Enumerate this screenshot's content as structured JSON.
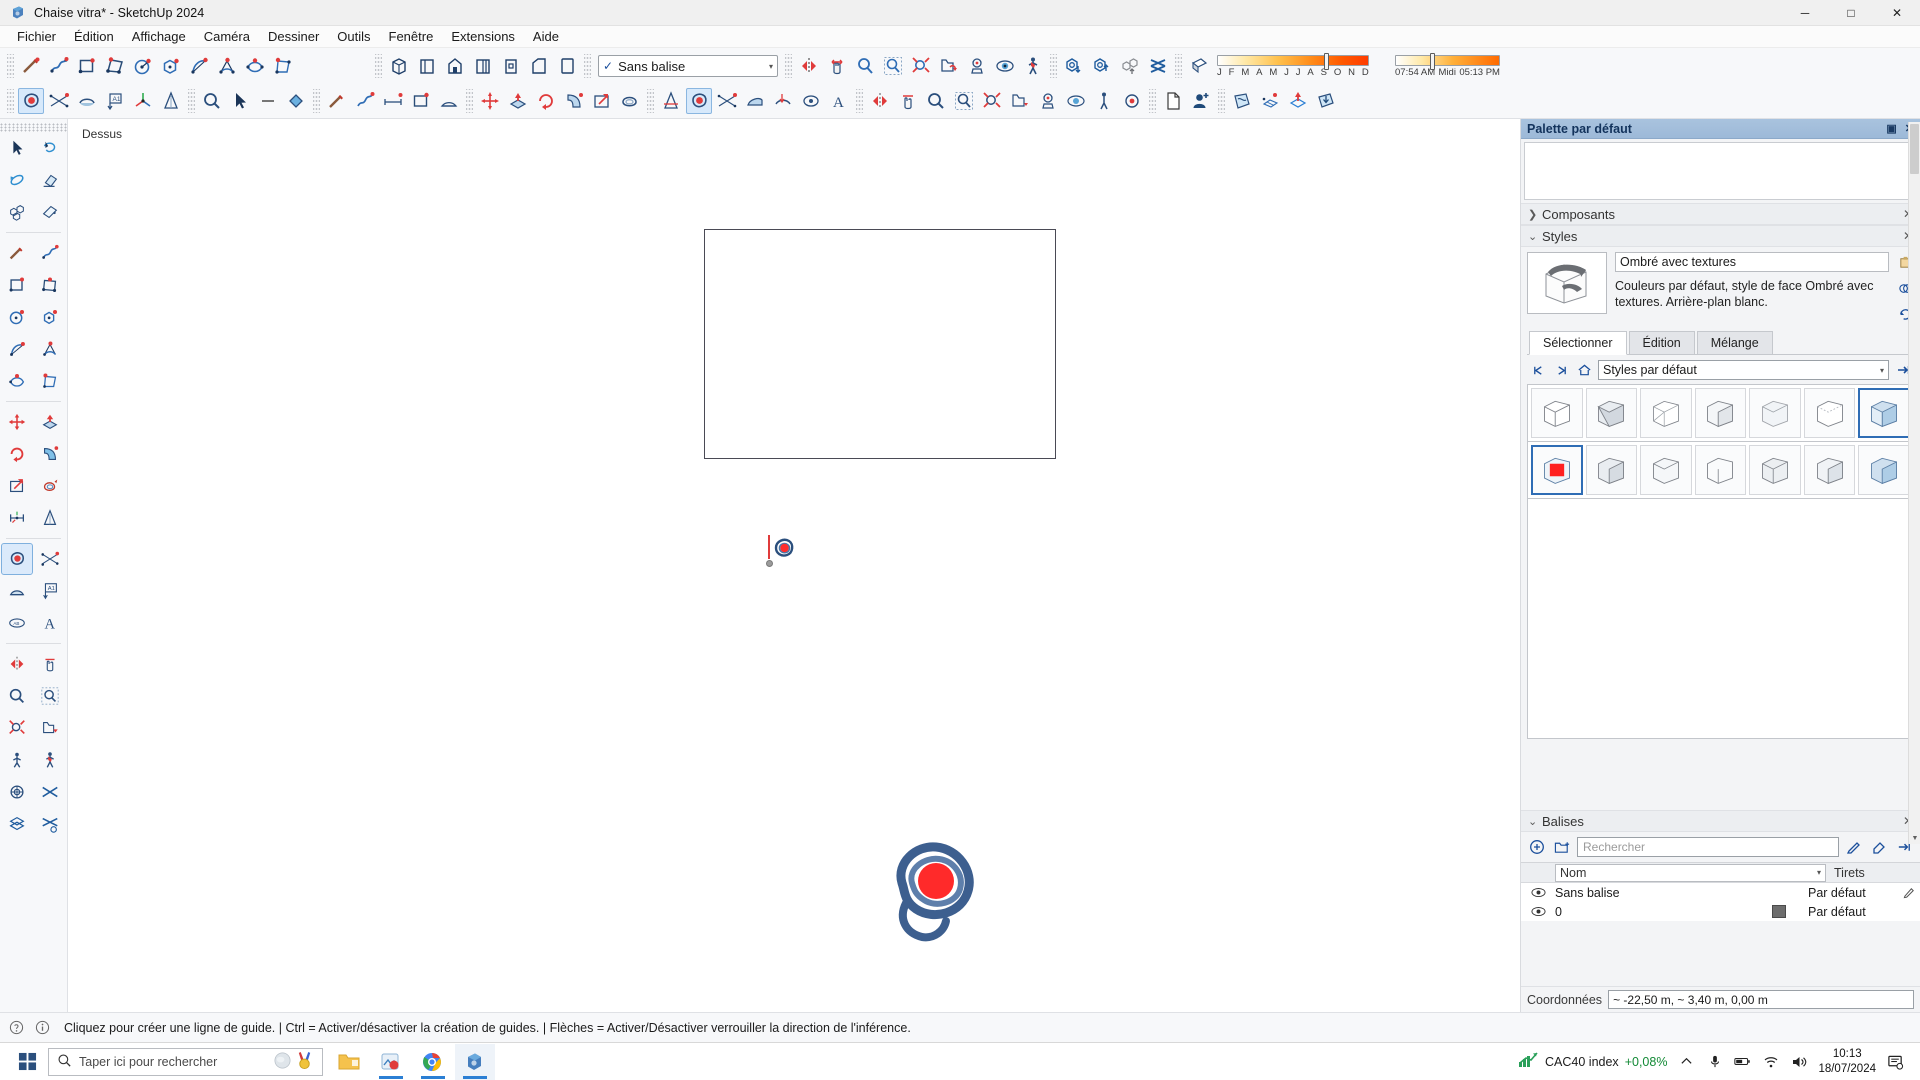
{
  "window": {
    "title": "Chaise vitra* - SketchUp 2024",
    "minimize": "─",
    "maximize": "□",
    "close": "✕"
  },
  "menu": [
    "Fichier",
    "Édition",
    "Affichage",
    "Caméra",
    "Dessiner",
    "Outils",
    "Fenêtre",
    "Extensions",
    "Aide"
  ],
  "toolbar": {
    "tag_selector": {
      "value": "Sans balise",
      "check": "✓",
      "arrow": "▾"
    },
    "row1_icons": [
      "line-icon",
      "freehand-icon",
      "rectangle-icon",
      "rotated-rectangle-icon",
      "circle-icon",
      "polygon-icon",
      "arc-icon",
      "2point-arc-icon",
      "3point-arc-icon",
      "pie-icon",
      "orbit-scenes-icon",
      "standard-views-icon",
      "iso-view-icon",
      "front-view-icon",
      "top-view-icon",
      "right-view-icon",
      "back-view-icon",
      "mirror-icon",
      "pan-icon",
      "zoom-icon",
      "zoom-window-icon",
      "zoom-extents-icon",
      "previous-view-icon",
      "position-camera-icon",
      "look-around-icon",
      "walk-icon",
      "solid-union-icon",
      "solid-subtract-icon",
      "solid-split-icon",
      "solid-intersect-icon",
      "shadow-toggle-icon"
    ],
    "row2_icons": [
      "select-icon",
      "lasso-icon",
      "eraser-icon",
      "text-icon",
      "paint-bucket-icon",
      "dimension-icon",
      "zoom-tool-icon",
      "select-arrow-icon",
      "measure-icon",
      "paint-icon",
      "pencil-icon",
      "eraser2-icon",
      "tape-measure-icon",
      "protractor-icon",
      "axes-icon",
      "move-icon",
      "push-pull-icon",
      "rotate-icon",
      "follow-me-icon",
      "scale-icon",
      "offset-icon",
      "section-plane-icon",
      "sandbox-icon",
      "outliner-icon",
      "account-icon",
      "new-file-icon",
      "add-person-icon",
      "texture-icon",
      "grid-icon",
      "extrude-icon",
      "import-icon"
    ]
  },
  "shadow": {
    "month_labels": [
      "J",
      "F",
      "M",
      "A",
      "M",
      "J",
      "J",
      "A",
      "S",
      "O",
      "N",
      "D"
    ],
    "time_labels": [
      "07:54 AM",
      "Midi",
      "05:13 PM"
    ],
    "month_thumb_pct": 70,
    "time_thumb_pct": 33
  },
  "canvas": {
    "view_label": "Dessus",
    "cursor_icon": "offset-cursor-icon",
    "thumbnail_icon": "offset-tool-large-icon"
  },
  "right_panel": {
    "title": "Palette par défaut",
    "title_controls": [
      "▣",
      "✕"
    ],
    "sections": [
      {
        "name": "Composants",
        "caret": "❯",
        "close": "✕",
        "expanded": false
      },
      {
        "name": "Styles",
        "caret": "⌄",
        "close": "✕",
        "expanded": true
      },
      {
        "name": "Balises",
        "caret": "⌄",
        "close": "✕",
        "expanded": true
      }
    ],
    "styles": {
      "style_name": "Ombré avec textures",
      "style_description": "Couleurs par défaut, style de face Ombré avec textures. Arrière-plan blanc.",
      "side_icons": [
        "create-style-icon",
        "mix-style-icon",
        "update-style-icon"
      ],
      "tabs": [
        {
          "label": "Sélectionner",
          "selected": true
        },
        {
          "label": "Édition",
          "selected": false
        },
        {
          "label": "Mélange",
          "selected": false
        }
      ],
      "nav_icons": [
        "back-arrow-icon",
        "forward-arrow-icon",
        "home-icon"
      ],
      "library": {
        "value": "Styles par défaut",
        "arrow": "▾"
      },
      "details_icon": "details-arrow-icon",
      "swatches_row1": [
        {
          "name": "style-swatch-hidden-line",
          "selected": false
        },
        {
          "name": "style-swatch-shaded",
          "selected": false
        },
        {
          "name": "style-swatch-wireframe",
          "selected": false
        },
        {
          "name": "style-swatch-monochrome",
          "selected": false
        },
        {
          "name": "style-swatch-xray",
          "selected": false
        },
        {
          "name": "style-swatch-back-edges",
          "selected": false
        },
        {
          "name": "style-swatch-shaded-textures",
          "selected": true
        }
      ],
      "swatches_row2": [
        {
          "name": "style-swatch-color-red",
          "selected": true
        },
        {
          "name": "style-swatch-simple",
          "selected": false
        },
        {
          "name": "style-swatch-plain",
          "selected": false
        },
        {
          "name": "style-swatch-basic",
          "selected": false
        },
        {
          "name": "style-swatch-default",
          "selected": false
        },
        {
          "name": "style-swatch-texture2",
          "selected": false
        },
        {
          "name": "style-swatch-sketch",
          "selected": false
        }
      ]
    },
    "tags": {
      "toolbar_icons": [
        "add-tag-icon",
        "add-tag-folder-icon",
        "tag-pencil-icon",
        "tag-eraser-icon",
        "tag-details-icon"
      ],
      "search_placeholder": "Rechercher",
      "columns": {
        "name": "Nom",
        "dashes": "Tirets",
        "arrow": "▾"
      },
      "rows": [
        {
          "visible": true,
          "eye": "◉",
          "name": "Sans balise",
          "color": "",
          "dashes": "Par défaut",
          "has_pencil": true
        },
        {
          "visible": true,
          "eye": "◉",
          "name": "0",
          "color": "#6d6d6d",
          "dashes": "Par défaut",
          "has_pencil": false
        }
      ]
    },
    "coordinates": {
      "label": "Coordonnées",
      "value": "~ -22,50 m, ~ 3,40 m, 0,00 m"
    }
  },
  "status_bar": {
    "icons": [
      "help-icon",
      "info-icon"
    ],
    "message": "Cliquez pour créer une ligne de guide. | Ctrl = Activer/désactiver la création de guides. | Flèches = Activer/Désactiver verrouiller la direction de l'inférence."
  },
  "taskbar": {
    "start_icon": "windows-start-icon",
    "search_placeholder": "Taper ici pour rechercher",
    "search_icon": "search-icon",
    "search_extras": [
      "weather-icon",
      "medal-icon"
    ],
    "apps": [
      {
        "name": "file-explorer-icon",
        "active": false,
        "underline": false
      },
      {
        "name": "photos-app-icon",
        "active": false,
        "underline": true
      },
      {
        "name": "chrome-icon",
        "active": false,
        "underline": true
      },
      {
        "name": "sketchup-icon",
        "active": true,
        "underline": true
      }
    ],
    "tray": {
      "stock_label": "CAC40 index",
      "stock_change": "+0,08%",
      "icons": [
        "chevron-up-icon",
        "microphone-icon",
        "battery-icon",
        "wifi-icon",
        "volume-icon",
        "notification-icon"
      ],
      "time": "10:13",
      "date": "18/07/2024"
    }
  },
  "colors": {
    "accent_blue": "#1b4f9c",
    "red": "#e03b3b",
    "title_bar": "#f0f0f0",
    "panel_header": "#a9c3de",
    "toolbar_bg": "#f7f8fa"
  }
}
